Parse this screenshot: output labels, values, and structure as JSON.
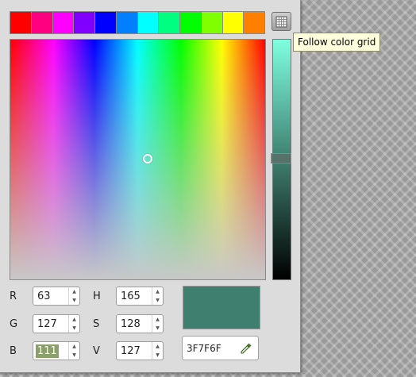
{
  "swatch_colors": [
    "#ff0000",
    "#ff0080",
    "#ff00ff",
    "#8000ff",
    "#0000ff",
    "#0080ff",
    "#00ffff",
    "#00ff80",
    "#00ff00",
    "#80ff00",
    "#ffff00",
    "#ff8000"
  ],
  "tooltip": "Follow color grid",
  "rgb": {
    "r_label": "R",
    "r_value": "63",
    "g_label": "G",
    "g_value": "127",
    "b_label": "B",
    "b_value": "111"
  },
  "hsv": {
    "h_label": "H",
    "h_value": "165",
    "s_label": "S",
    "s_value": "128",
    "v_label": "V",
    "v_value": "127"
  },
  "current_color": "#3f7f6f",
  "hex_value": "3F7F6F",
  "icons": {
    "grid_toggle": "grid-icon",
    "eyedropper": "eyedropper-icon"
  }
}
